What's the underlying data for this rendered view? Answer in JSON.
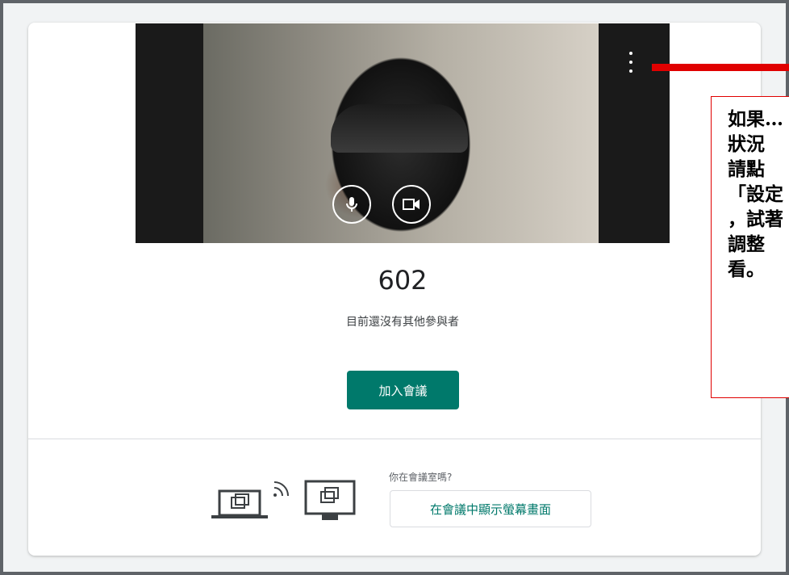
{
  "meeting": {
    "room_name": "602",
    "status_text": "目前還沒有其他參與者",
    "join_label": "加入會議"
  },
  "icons": {
    "microphone": "microphone-icon",
    "camera": "videocam-icon",
    "more": "more-vert-icon",
    "devices": "cast-to-device-icon"
  },
  "present": {
    "question": "你在會議室嗎?",
    "button_label": "在會議中顯示螢幕畫面"
  },
  "annotation": {
    "lines": "如果…\n狀況\n請點\n「設定\n，試著\n調整\n看。"
  },
  "colors": {
    "accent": "#00796b",
    "annotation_red": "#e00000"
  }
}
